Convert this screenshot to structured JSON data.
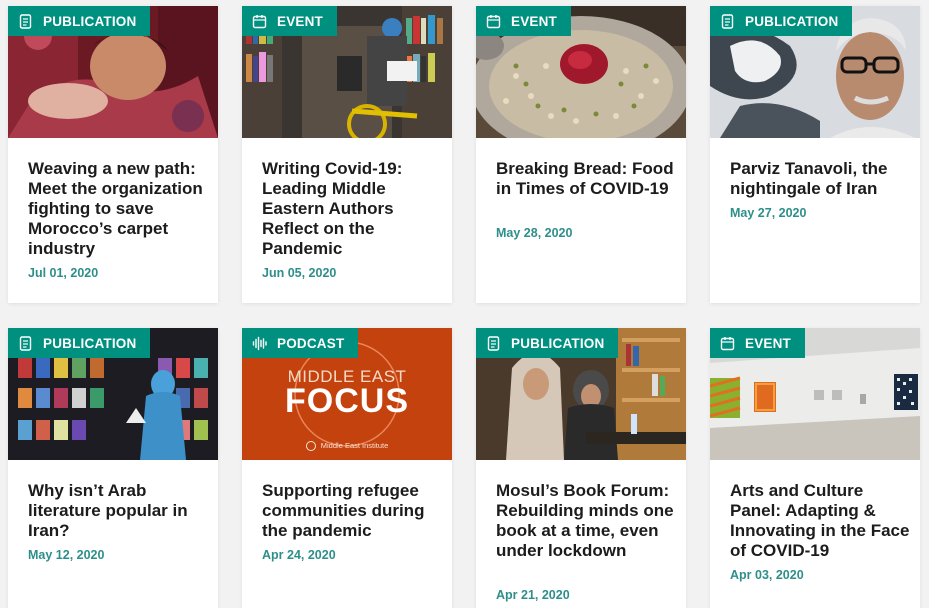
{
  "colors": {
    "accent": "#00907f",
    "date": "#2e8f8a",
    "title": "#1c1c1c"
  },
  "cards": [
    {
      "type": "PUBLICATION",
      "icon": "document-icon",
      "title": "Weaving a new path: Meet the organization fighting to save Morocco’s carpet industry",
      "date": "Jul 01, 2020"
    },
    {
      "type": "EVENT",
      "icon": "calendar-icon",
      "title": "Writing Covid-19: Leading Middle Eastern Authors Reflect on the Pandemic",
      "date": "Jun 05, 2020"
    },
    {
      "type": "EVENT",
      "icon": "calendar-icon",
      "title": "Breaking Bread: Food in Times of COVID-19",
      "date": "May 28, 2020"
    },
    {
      "type": "PUBLICATION",
      "icon": "document-icon",
      "title": "Parviz Tanavoli, the nightingale of Iran",
      "date": "May 27, 2020"
    },
    {
      "type": "PUBLICATION",
      "icon": "document-icon",
      "title": "Why isn’t Arab literature popular in Iran?",
      "date": "May 12, 2020"
    },
    {
      "type": "PODCAST",
      "icon": "waveform-icon",
      "title": "Supporting refugee communities during the pandemic",
      "date": "Apr 24, 2020",
      "image_text": {
        "line1": "MIDDLE EAST",
        "line2": "FOCUS",
        "org": "Middle East Institute"
      }
    },
    {
      "type": "PUBLICATION",
      "icon": "document-icon",
      "title": "Mosul’s Book Forum: Rebuilding minds one book at a time, even under lockdown",
      "date": "Apr 21, 2020"
    },
    {
      "type": "EVENT",
      "icon": "calendar-icon",
      "title": "Arts and Culture Panel: Adapting & Innovating in the Face of COVID-19",
      "date": "Apr 03, 2020"
    }
  ]
}
